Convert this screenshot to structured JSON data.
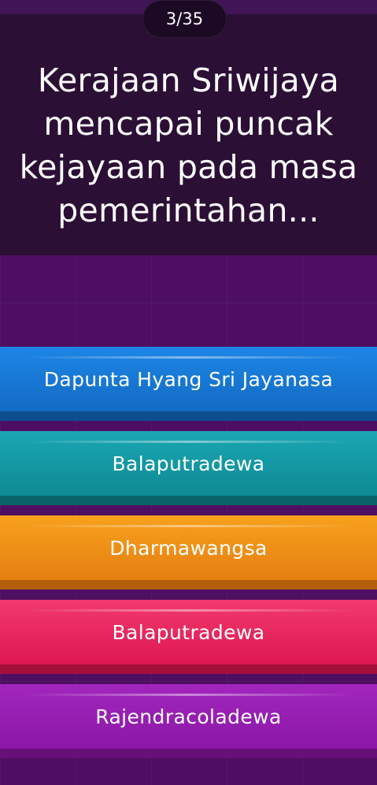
{
  "quiz": {
    "counter": "3/35",
    "question": "Kerajaan Sriwijaya mencapai puncak kejayaan pada masa pemerintahan...",
    "answers": [
      {
        "label": "Dapunta Hyang Sri Jayanasa",
        "color": "#1877d6"
      },
      {
        "label": "Balaputradewa",
        "color": "#1499a4"
      },
      {
        "label": "Dharmawangsa",
        "color": "#f09218"
      },
      {
        "label": "Balaputradewa",
        "color": "#ea2a60"
      },
      {
        "label": "Rajendracoladewa",
        "color": "#971fb2"
      }
    ]
  }
}
